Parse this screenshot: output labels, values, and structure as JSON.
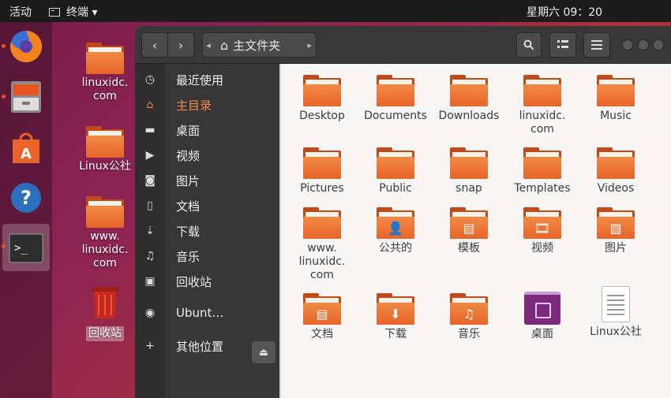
{
  "topbar": {
    "activities": "活动",
    "app_menu": "终端 ▾",
    "clock": "星期六 09：20"
  },
  "desktop_icons": [
    {
      "label": "linuxidc.\ncom"
    },
    {
      "label": "Linux公社"
    },
    {
      "label": "www.\nlinuxidc.\ncom"
    },
    {
      "label": "回收站"
    }
  ],
  "window": {
    "path": "主文件夹",
    "sidebar": [
      {
        "label": "最近使用",
        "icon": "clock-icon"
      },
      {
        "label": "主目录",
        "icon": "home-icon"
      },
      {
        "label": "桌面",
        "icon": "folder-icon"
      },
      {
        "label": "视频",
        "icon": "video-icon"
      },
      {
        "label": "图片",
        "icon": "camera-icon"
      },
      {
        "label": "文档",
        "icon": "document-icon"
      },
      {
        "label": "下载",
        "icon": "download-icon"
      },
      {
        "label": "音乐",
        "icon": "music-icon"
      },
      {
        "label": "回收站",
        "icon": "trash-icon"
      },
      {
        "label": "Ubunt…",
        "icon": "disc-icon"
      },
      {
        "label": "其他位置",
        "icon": "plus-icon"
      }
    ],
    "files": [
      {
        "label": "Desktop"
      },
      {
        "label": "Documents"
      },
      {
        "label": "Downloads"
      },
      {
        "label": "linuxidc.\ncom"
      },
      {
        "label": "Music"
      },
      {
        "label": "Pictures"
      },
      {
        "label": "Public"
      },
      {
        "label": "snap"
      },
      {
        "label": "Templates"
      },
      {
        "label": "Videos"
      },
      {
        "label": "www.\nlinuxidc.\ncom"
      },
      {
        "label": "公共的"
      },
      {
        "label": "模板"
      },
      {
        "label": "视频"
      },
      {
        "label": "图片"
      },
      {
        "label": "文档"
      },
      {
        "label": "下载"
      },
      {
        "label": "音乐"
      },
      {
        "label": "桌面"
      },
      {
        "label": "Linux公社"
      }
    ]
  },
  "colors": {
    "accent": "#e95420",
    "folder_orange": "#ef7d3c",
    "sidebar_bg": "#373737",
    "header_bg": "#383838"
  }
}
